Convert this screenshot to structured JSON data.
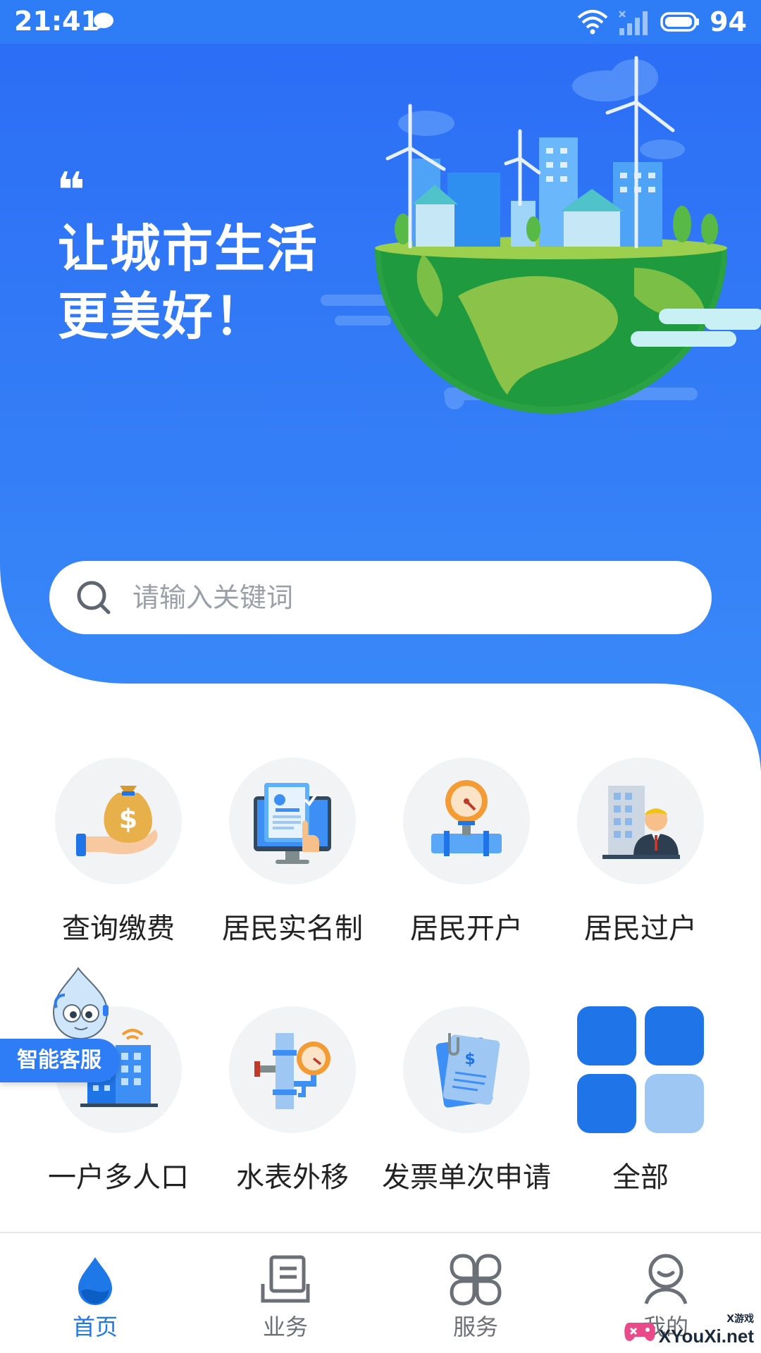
{
  "status_bar": {
    "time": "21:41",
    "battery": "94",
    "icons": [
      "chat-bubble-icon",
      "wifi-icon",
      "signal-icon",
      "battery-icon"
    ]
  },
  "hero": {
    "quote_mark": "❝",
    "slogan_line1": "让城市生活",
    "slogan_line2": "更美好！",
    "illustration": "green-city-globe-with-wind-turbines"
  },
  "search": {
    "placeholder": "请输入关键词",
    "value": ""
  },
  "services": [
    {
      "label": "查询缴费",
      "icon": "money-bag-hand-icon"
    },
    {
      "label": "居民实名制",
      "icon": "id-document-screen-icon"
    },
    {
      "label": "居民开户",
      "icon": "water-meter-pipe-icon"
    },
    {
      "label": "居民过户",
      "icon": "person-building-icon"
    },
    {
      "label": "一户多人口",
      "icon": "apartment-building-icon"
    },
    {
      "label": "水表外移",
      "icon": "meter-relocation-icon"
    },
    {
      "label": "发票单次申请",
      "icon": "invoice-document-icon"
    },
    {
      "label": "全部",
      "icon": "all-grid-icon"
    }
  ],
  "assistant": {
    "label": "智能客服",
    "icon": "water-drop-mascot-icon"
  },
  "nav": {
    "items": [
      {
        "label": "首页",
        "icon": "water-drop-icon",
        "active": true
      },
      {
        "label": "业务",
        "icon": "document-tray-icon",
        "active": false
      },
      {
        "label": "服务",
        "icon": "four-leaf-grid-icon",
        "active": false
      },
      {
        "label": "我的",
        "icon": "profile-icon",
        "active": false
      }
    ]
  },
  "watermark": {
    "small": "X游戏",
    "text": "XYouXi.net"
  },
  "colors": {
    "primary": "#2e7cf6",
    "primary_dark": "#1f6ff0",
    "nav_active": "#1f78e8",
    "nav_inactive": "#6b6f76",
    "circle_bg": "#f2f3f5"
  }
}
